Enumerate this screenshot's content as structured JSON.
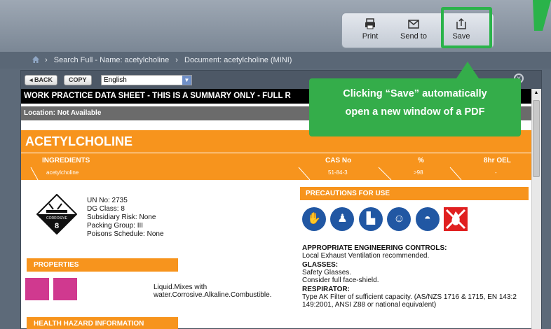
{
  "toolbar": {
    "print_label": "Print",
    "sendto_label": "Send to",
    "save_label": "Save"
  },
  "breadcrumb": {
    "item1": "Search Full - Name: acetylcholine",
    "item2": "Document: acetylcholine (MINI)"
  },
  "controls": {
    "back_label": "◂ BACK",
    "copy_label": "COPY",
    "language": "English",
    "close": "✕"
  },
  "doc": {
    "banner": "WORK PRACTICE DATA SHEET - THIS IS A SUMMARY ONLY - FULL R",
    "location": "Location: Not Available",
    "title": "ACETYLCHOLINE",
    "ingredients_header": "INGREDIENTS",
    "ingredient_name": "acetylcholine",
    "cas_header": "CAS No",
    "cas_value": "51-84-3",
    "pct_header": "%",
    "pct_value": ">98",
    "oel_header": "8hr OEL",
    "oel_value": "-",
    "diamond_label": "CORROSIVE",
    "diamond_class": "8",
    "un_no": "UN No: 2735",
    "dg_class": "DG Class: 8",
    "subsidiary_risk": "Subsidiary Risk: None",
    "packing_group": "Packing Group: III",
    "poisons_schedule": "Poisons Schedule: None",
    "properties_header": "PROPERTIES",
    "properties_text1": "Liquid.Mixes with",
    "properties_text2": "water.Corrosive.Alkaline.Combustible.",
    "health_header": "HEALTH HAZARD INFORMATION",
    "precautions_header": "PRECAUTIONS FOR USE",
    "eng_controls_heading": "APPROPRIATE ENGINEERING CONTROLS:",
    "eng_controls_text": "Local Exhaust Ventilation recommended.",
    "glasses_heading": "GLASSES:",
    "glasses_text1": "Safety Glasses.",
    "glasses_text2": "Consider full face-shield.",
    "respirator_heading": "RESPIRATOR:",
    "respirator_text1": "Type AK Filter of sufficient capacity. (AS/NZS 1716 & 1715, EN 143:2",
    "respirator_text2": "149:2001, ANSI Z88 or national equivalent)"
  },
  "callout": {
    "line1": "Clicking “Save” automatically",
    "line2": "open a new window of a PDF"
  },
  "colors": {
    "accent_orange": "#f7941d",
    "callout_green": "#34ad4a",
    "ppe_blue": "#2157a3",
    "property_pink": "#d0398f"
  }
}
